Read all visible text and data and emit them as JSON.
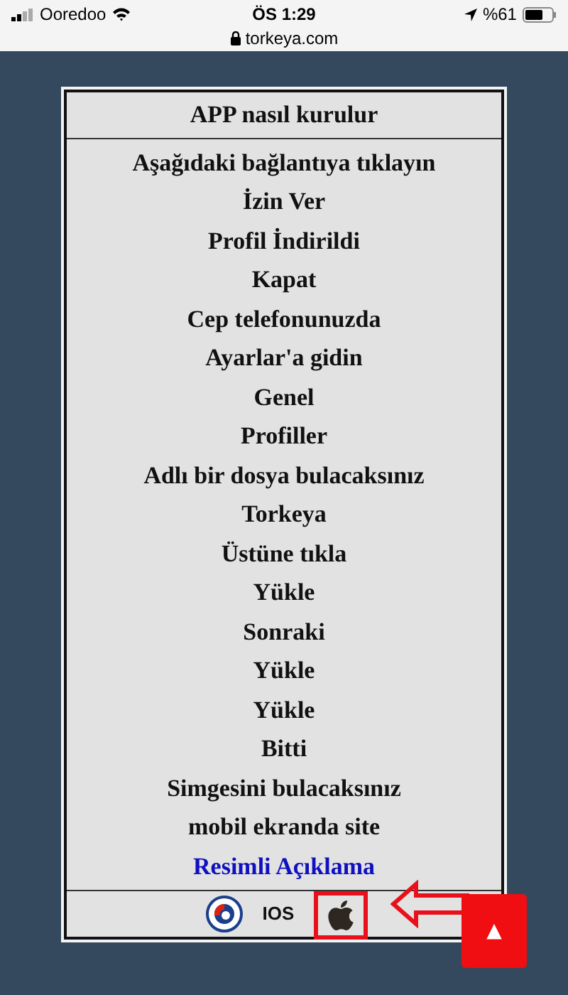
{
  "status_bar": {
    "carrier": "Ooredoo",
    "time": "ÖS 1:29",
    "battery": "%61"
  },
  "address_bar": {
    "url": "torkeya.com"
  },
  "card": {
    "title": "APP nasıl kurulur",
    "steps": [
      "Aşağıdaki bağlantıya tıklayın",
      "İzin Ver",
      "Profil İndirildi",
      "Kapat",
      "Cep telefonunuzda",
      "Ayarlar'a gidin",
      "Genel",
      "Profiller",
      "Adlı bir dosya bulacaksınız",
      "Torkeya",
      "Üstüne tıkla",
      "Yükle",
      "Sonraki",
      "Yükle",
      "Yükle",
      "Bitti",
      "Simgesini bulacaksınız",
      "mobil ekranda site"
    ],
    "link": "Resimli Açıklama",
    "footer": {
      "label": "IOS"
    }
  },
  "scroll_top_button": {
    "symbol": "▲"
  }
}
